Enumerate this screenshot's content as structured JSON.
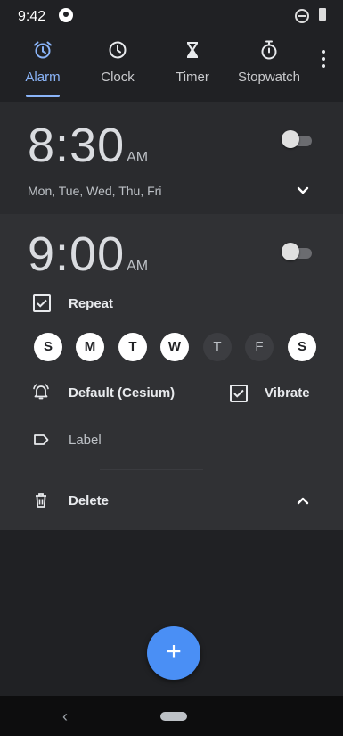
{
  "status": {
    "time": "9:42"
  },
  "tabs": [
    {
      "label": "Alarm",
      "icon": "alarm-icon",
      "active": true
    },
    {
      "label": "Clock",
      "icon": "clock-icon",
      "active": false
    },
    {
      "label": "Timer",
      "icon": "hourglass-icon",
      "active": false
    },
    {
      "label": "Stopwatch",
      "icon": "stopwatch-icon",
      "active": false
    }
  ],
  "alarms": [
    {
      "time": "8:30",
      "ampm": "AM",
      "enabled": false,
      "days_summary": "Mon, Tue, Wed, Thu, Fri"
    },
    {
      "time": "9:00",
      "ampm": "AM",
      "enabled": false,
      "repeat_label": "Repeat",
      "repeat_checked": true,
      "days": [
        {
          "letter": "S",
          "on": true
        },
        {
          "letter": "M",
          "on": true
        },
        {
          "letter": "T",
          "on": true
        },
        {
          "letter": "W",
          "on": true
        },
        {
          "letter": "T",
          "on": false
        },
        {
          "letter": "F",
          "on": false
        },
        {
          "letter": "S",
          "on": true
        }
      ],
      "ringtone_label": "Default (Cesium)",
      "vibrate_label": "Vibrate",
      "vibrate_checked": true,
      "label_placeholder": "Label",
      "delete_label": "Delete"
    }
  ],
  "fab": {
    "label": "+"
  },
  "nav": {
    "back": "‹"
  },
  "colors": {
    "accent": "#8ab4f8",
    "fab": "#4a8ff5",
    "background": "#202124"
  }
}
